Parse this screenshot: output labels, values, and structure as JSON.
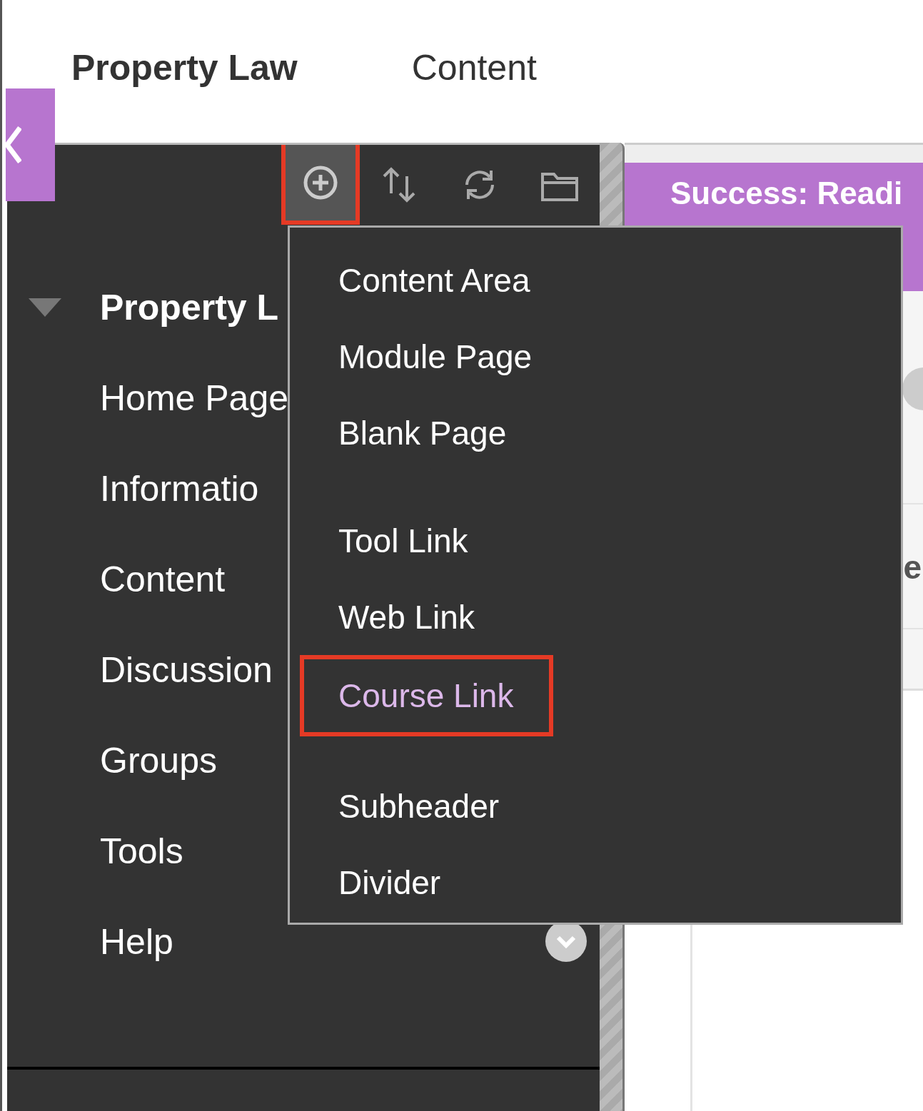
{
  "header": {
    "course_title": "Property Law",
    "page_title": "Content"
  },
  "toolbar": [
    {
      "kind": "add",
      "active": true
    },
    {
      "kind": "sort",
      "active": false
    },
    {
      "kind": "refresh",
      "active": false
    },
    {
      "kind": "folder",
      "active": false
    }
  ],
  "sidebar": {
    "course": {
      "label": "Property L",
      "expanded": true
    },
    "items": [
      {
        "label": "Home Page"
      },
      {
        "label": "Informatio"
      },
      {
        "label": "Content"
      },
      {
        "label": "Discussion"
      },
      {
        "label": "Groups"
      },
      {
        "label": "Tools"
      },
      {
        "label": "Help",
        "has_menu": true
      }
    ]
  },
  "banner": {
    "text": "Success: Readi"
  },
  "content_fragment": "e",
  "add_menu": {
    "groups": [
      [
        {
          "label": "Content Area",
          "selected": false
        },
        {
          "label": "Module Page",
          "selected": false
        },
        {
          "label": "Blank Page",
          "selected": false
        }
      ],
      [
        {
          "label": "Tool Link",
          "selected": false
        },
        {
          "label": "Web Link",
          "selected": false
        },
        {
          "label": "Course Link",
          "selected": true
        }
      ],
      [
        {
          "label": "Subheader",
          "selected": false
        },
        {
          "label": "Divider",
          "selected": false
        }
      ]
    ]
  }
}
